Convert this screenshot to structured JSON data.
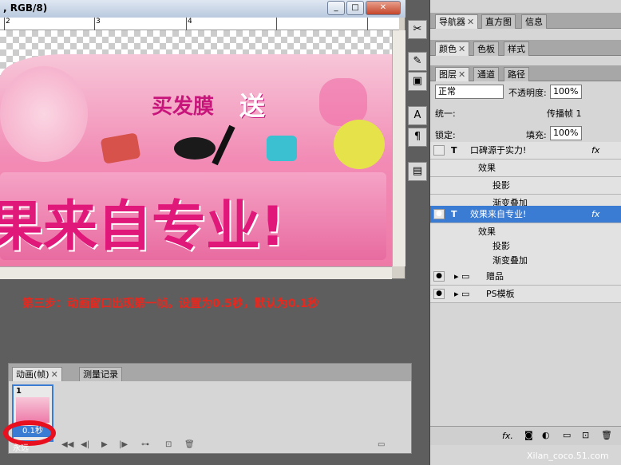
{
  "document": {
    "title": ", RGB/8)",
    "ruler_numbers": [
      "2",
      "3",
      "4"
    ],
    "banner_text_buy": "买发膜",
    "banner_text_send": "送",
    "banner_big_text": "果来自专业!"
  },
  "instruction": "第三步：动画窗口出现第一帧。设置为0.5秒，默认为0.1秒",
  "tool_icons": [
    "scissors-icon",
    "pen-icon",
    "stamp-icon",
    "type-icon",
    "paragraph-icon",
    "notes-icon"
  ],
  "panels": {
    "row1_tabs": [
      "导航器",
      "直方图",
      "信息"
    ],
    "row2_tabs": [
      "颜色",
      "色板",
      "样式"
    ],
    "layers_tabs": [
      "图层",
      "通道",
      "路径"
    ],
    "blend_mode": "正常",
    "opacity_label": "不透明度:",
    "opacity_value": "100%",
    "unify_label": "统一:",
    "propagate_label": "传播帧 1",
    "lock_label": "锁定:",
    "fill_label": "填充:",
    "fill_value": "100%",
    "layers": [
      {
        "name": "口碑源于实力!",
        "fx": "fx"
      },
      {
        "name": "效果"
      },
      {
        "name": "投影"
      },
      {
        "name": "渐变叠加"
      },
      {
        "name": "效果来自专业!",
        "fx": "fx"
      },
      {
        "name": "效果"
      },
      {
        "name": "投影"
      },
      {
        "name": "渐变叠加"
      },
      {
        "name": "赠品"
      },
      {
        "name": "PS模板"
      }
    ]
  },
  "animation": {
    "tabs": [
      "动画(帧)",
      "测量记录"
    ],
    "frame_number": "1",
    "frame_time": "0.1秒",
    "loop": "永远"
  },
  "watermark": "Xilan_coco.51.com",
  "colors": {
    "accent": "#3a7cd3",
    "instruction": "#e8281e",
    "highlight": "#e8101e"
  }
}
